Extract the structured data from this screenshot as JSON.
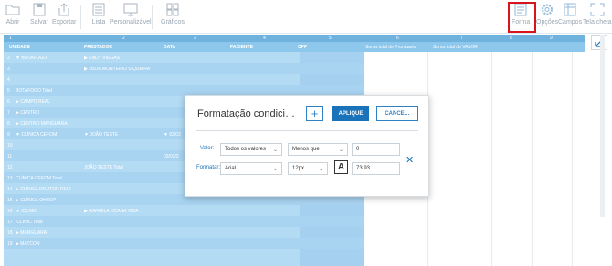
{
  "toolbar": {
    "items": [
      {
        "label": "Abrir",
        "icon": "folder-icon"
      },
      {
        "label": "Salvar",
        "icon": "save-icon"
      },
      {
        "label": "Exportar",
        "icon": "export-icon"
      },
      {
        "label": "Lista",
        "icon": "list-icon"
      },
      {
        "label": "Personalizável",
        "icon": "customize-icon"
      },
      {
        "label": "Gráficos",
        "icon": "chart-icon"
      },
      {
        "label": "Forma",
        "icon": "format-icon"
      },
      {
        "label": "Opções",
        "icon": "gear-icon"
      },
      {
        "label": "Campos",
        "icon": "fields-icon"
      },
      {
        "label": "Tela cheia",
        "icon": "fullscreen-icon"
      }
    ],
    "highlight_color": "#d8141c"
  },
  "grid": {
    "col_numbers": [
      "1",
      "2",
      "3",
      "4",
      "5",
      "6",
      "7",
      "8",
      "9"
    ],
    "field_headers": [
      "UNIDADE",
      "PRESTADOR",
      "DATA",
      "PACIENTE",
      "CPF",
      "Soma total de Prontuario",
      "Soma total de VALOR"
    ],
    "rows": [
      {
        "n": "2",
        "unidade": "▼ BOTAFOGO",
        "prestador": "▶ ENDY VIEGAS",
        "data": ""
      },
      {
        "n": "3",
        "unidade": "",
        "prestador": "▶ JÚLIA MONTEIRO SIQUEIRA",
        "data": ""
      },
      {
        "n": "4",
        "unidade": "",
        "prestador": "",
        "data": ""
      },
      {
        "n": "5",
        "unidade": "BOTAFOGO Total",
        "prestador": "",
        "data": ""
      },
      {
        "n": "6",
        "unidade": "▶ CAMPO REAL",
        "prestador": "",
        "data": ""
      },
      {
        "n": "7",
        "unidade": "▶ CENTRO",
        "prestador": "",
        "data": ""
      },
      {
        "n": "8",
        "unidade": "▶ CENTRO MANGUARA",
        "prestador": "",
        "data": ""
      },
      {
        "n": "9",
        "unidade": "▼ CLÍNICA CEFOM",
        "prestador": "▼ JOÃO TESTE",
        "data": "▼ 03/02"
      },
      {
        "n": "10",
        "unidade": "",
        "prestador": "",
        "data": ""
      },
      {
        "n": "11",
        "unidade": "",
        "prestador": "",
        "data": "03/02/2"
      },
      {
        "n": "12",
        "unidade": "",
        "prestador": "JOÃO TESTE Total",
        "data": ""
      },
      {
        "n": "13",
        "unidade": "CLÍNICA CEFOM Total",
        "prestador": "",
        "data": ""
      },
      {
        "n": "14",
        "unidade": "▶ CLÍNICA DOUTOR REIS",
        "prestador": "",
        "data": ""
      },
      {
        "n": "15",
        "unidade": "▶ CLÍNICA OHBOP",
        "prestador": "",
        "data": ""
      },
      {
        "n": "16",
        "unidade": "▼ ICLINIC",
        "prestador": "▶ RAFAELA OCANA VIDA",
        "data": ""
      },
      {
        "n": "17",
        "unidade": "ICLINIC Total",
        "prestador": "",
        "data": ""
      },
      {
        "n": "18",
        "unidade": "▶ MANGUARA",
        "prestador": "",
        "data": ""
      },
      {
        "n": "19",
        "unidade": "▶ MATCON",
        "prestador": "",
        "data": ""
      }
    ],
    "header_color": "#6fb2de",
    "row_color": "#b4dbf4"
  },
  "dialog": {
    "title": "Formatação condici…",
    "plus_label": "+",
    "apply_label": "APLIQUE",
    "cancel_label": "CANCE…",
    "valor_label": "Valor:",
    "valor_field": "Todos os valores",
    "operator": "Menos que",
    "value": "0",
    "formatar_label": "Formatar:",
    "font": "Arial",
    "size": "12px",
    "font_button": "A",
    "preview": "73.93",
    "remove_label": "✕"
  }
}
